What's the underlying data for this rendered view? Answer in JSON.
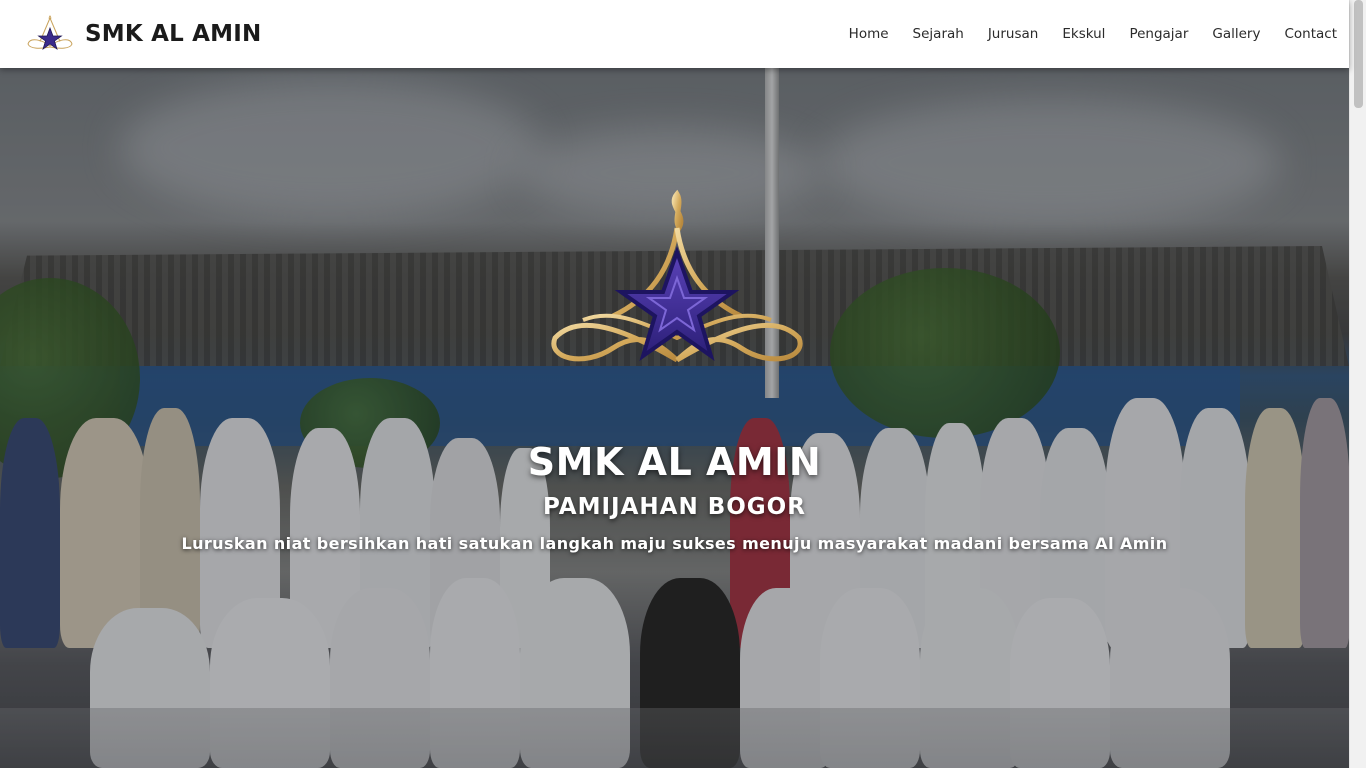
{
  "brand": {
    "name": "SMK AL AMIN",
    "logo_icon": "star-ornament-icon"
  },
  "nav": {
    "items": [
      {
        "label": "Home"
      },
      {
        "label": "Sejarah"
      },
      {
        "label": "Jurusan"
      },
      {
        "label": "Ekskul"
      },
      {
        "label": "Pengajar"
      },
      {
        "label": "Gallery"
      },
      {
        "label": "Contact"
      }
    ]
  },
  "hero": {
    "logo_icon": "star-ornament-icon",
    "title": "SMK AL AMIN",
    "subtitle": "PAMIJAHAN BOGOR",
    "tagline": "Luruskan niat bersihkan hati satukan langkah maju sukses menuju masyarakat madani bersama Al Amin"
  },
  "colors": {
    "star": "#3b2a8a",
    "ornament": "#d9b46a",
    "nav_text": "#2b2b2b"
  }
}
